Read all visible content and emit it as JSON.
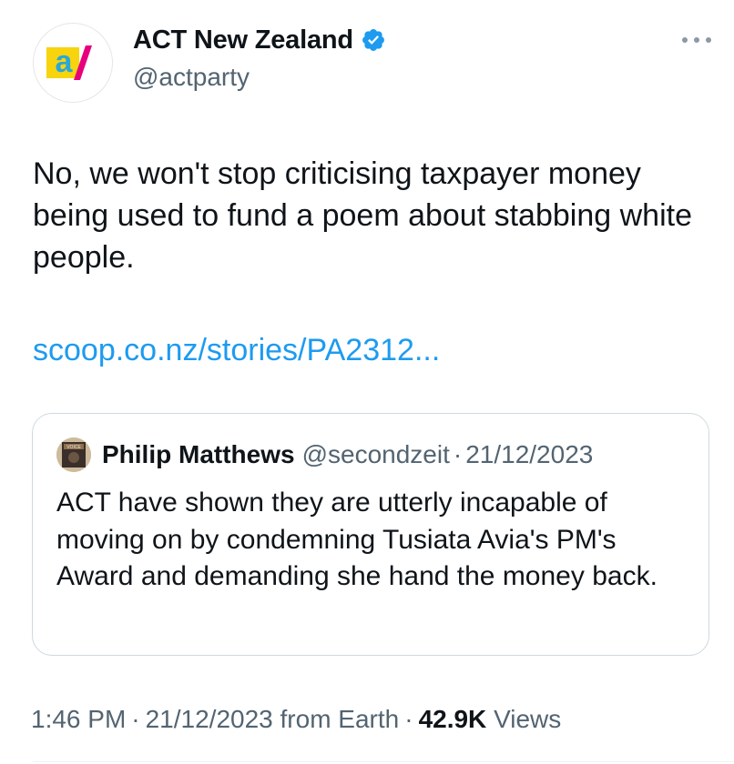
{
  "author": {
    "display_name": "ACT New Zealand",
    "handle": "@actparty",
    "avatar_icon": "act-logo",
    "logo_letter": "a",
    "verified": true,
    "verified_color": "#1d9bf0"
  },
  "more_icon": "more-horizontal-icon",
  "tweet": {
    "text": "No, we won't stop criticising taxpayer money being used to fund a poem about stabbing white people.",
    "link": "scoop.co.nz/stories/PA2312..."
  },
  "quoted": {
    "display_name": "Philip Matthews",
    "handle": "@secondzeit",
    "dot": "·",
    "date": "21/12/2023",
    "text": "ACT have shown they are utterly incapable of moving on by condemning Tusiata Avia's PM's Award and demanding she hand the money back.",
    "avatar_icon": "book-cover-avatar",
    "avatar_label": "VOICE"
  },
  "meta": {
    "time": "1:46 PM",
    "sep1": "·",
    "date": "21/12/2023 from Earth",
    "sep2": "·",
    "views_count": "42.9K",
    "views_label": "Views"
  },
  "colors": {
    "link": "#1d9bf0",
    "secondary_text": "#536471",
    "logo_yellow": "#f7d40e",
    "logo_blue": "#29a8d8",
    "logo_magenta": "#e6007e"
  }
}
